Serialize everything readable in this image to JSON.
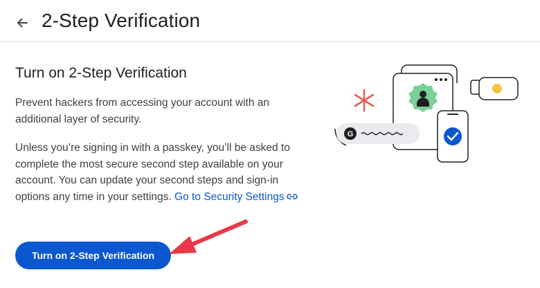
{
  "header": {
    "back_icon": "arrow-left-icon",
    "title": "2-Step Verification"
  },
  "content": {
    "title": "Turn on 2-Step Verification",
    "paragraph1": "Prevent hackers from accessing your account with an additional layer of security.",
    "paragraph2": "Unless you’re signing in with a passkey, you’ll be asked to complete the most secure second step available on your account. You can update your second steps and sign-in options any time in your settings.",
    "link_text": "Go to Security Settings",
    "link_icon": "link-icon",
    "button_label": "Turn on 2-Step Verification"
  },
  "colors": {
    "accent": "#0b57d0",
    "annotation_arrow": "#e8394a"
  }
}
